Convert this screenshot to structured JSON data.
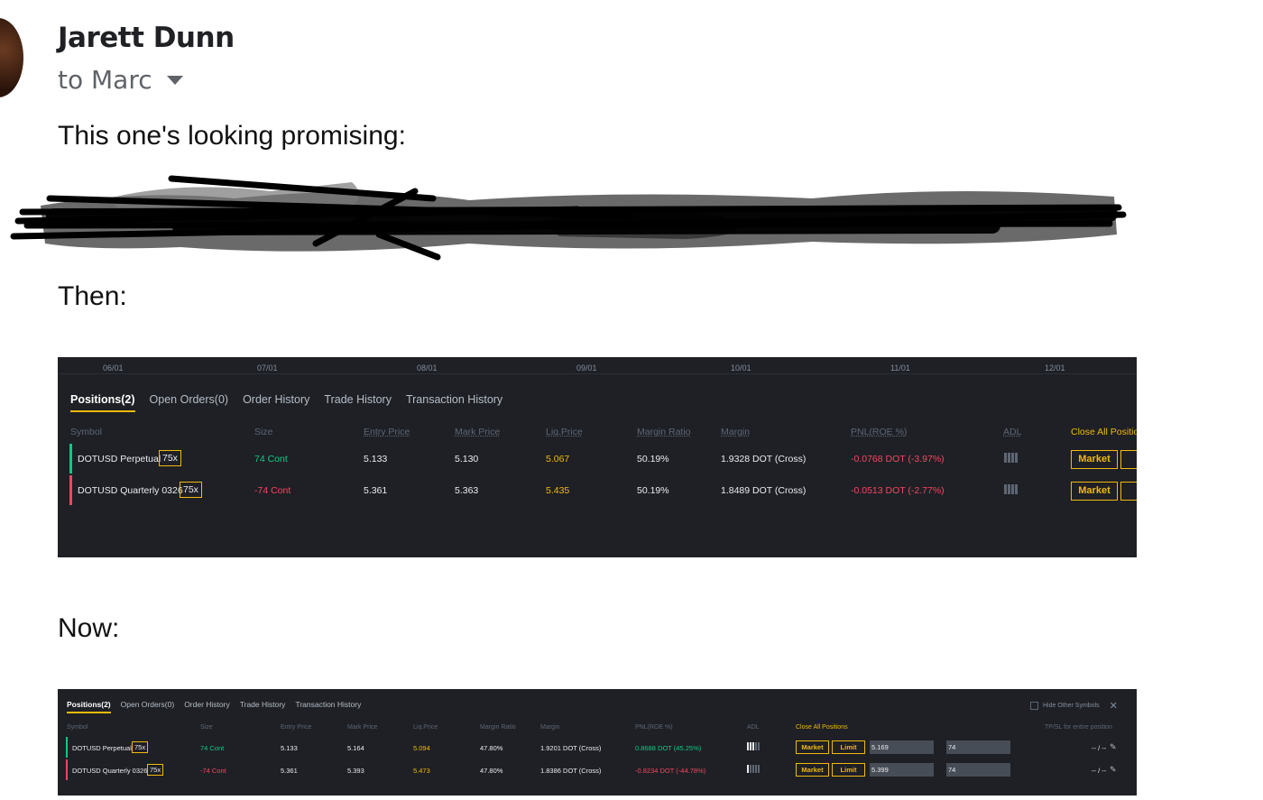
{
  "email": {
    "sender": "Jarett Dunn",
    "recipient": "to Marc",
    "line1": "This one's looking promising:",
    "line2": "Then:",
    "line3": "Now:"
  },
  "colors": {
    "accent": "#f0b90b",
    "green": "#0ecb81",
    "red": "#f6465d",
    "panel": "#1e2026"
  },
  "then": {
    "axis_dates": [
      "06/01",
      "07/01",
      "08/01",
      "09/01",
      "10/01",
      "11/01",
      "12/01"
    ],
    "tabs": [
      "Positions(2)",
      "Open Orders(0)",
      "Order History",
      "Trade History",
      "Transaction History"
    ],
    "headers": {
      "symbol": "Symbol",
      "size": "Size",
      "entry": "Entry Price",
      "mark": "Mark Price",
      "liq": "Liq.Price",
      "ratio": "Margin Ratio",
      "margin": "Margin",
      "pnl": "PNL(ROE %)",
      "adl": "ADL",
      "close": "Close All Positio"
    },
    "rows": [
      {
        "symbol": "DOTUSD Perpetual",
        "lev": "75x",
        "size": "74 Cont",
        "entry": "5.133",
        "mark": "5.130",
        "liq": "5.067",
        "ratio": "50.19%",
        "margin": "1.9328 DOT (Cross)",
        "pnl": "-0.0768 DOT (-3.97%)",
        "market": "Market"
      },
      {
        "symbol": "DOTUSD Quarterly 0326",
        "lev": "75x",
        "size": "-74 Cont",
        "entry": "5.361",
        "mark": "5.363",
        "liq": "5.435",
        "ratio": "50.19%",
        "margin": "1.8489 DOT (Cross)",
        "pnl": "-0.0513 DOT (-2.77%)",
        "market": "Market"
      }
    ]
  },
  "now": {
    "tabs": [
      "Positions(2)",
      "Open Orders(0)",
      "Order History",
      "Trade History",
      "Transaction History"
    ],
    "hide_label": "Hide Other Symbols",
    "headers": {
      "symbol": "Symbol",
      "size": "Size",
      "entry": "Entry Price",
      "mark": "Mark Price",
      "liq": "Liq.Price",
      "ratio": "Margin Ratio",
      "margin": "Margin",
      "pnl": "PNL(ROE %)",
      "adl": "ADL",
      "close": "Close All Positions",
      "tpsl": "TP/SL for entire position"
    },
    "rows": [
      {
        "symbol": "DOTUSD Perpetual",
        "lev": "75x",
        "size": "74 Cont",
        "entry": "5.133",
        "mark": "5.164",
        "liq": "5.094",
        "ratio": "47.80%",
        "margin": "1.9201 DOT (Cross)",
        "pnl": "0.8688 DOT (45.25%)",
        "market": "Market",
        "limit": "Limit",
        "price": "5.169",
        "qty": "74",
        "tpsl": "-- / --"
      },
      {
        "symbol": "DOTUSD Quarterly 0326",
        "lev": "75x",
        "size": "-74 Cont",
        "entry": "5.361",
        "mark": "5.393",
        "liq": "5.473",
        "ratio": "47.80%",
        "margin": "1.8386 DOT (Cross)",
        "pnl": "-0.8234 DOT (-44.78%)",
        "market": "Market",
        "limit": "Limit",
        "price": "5.399",
        "qty": "74",
        "tpsl": "-- / --"
      }
    ]
  }
}
